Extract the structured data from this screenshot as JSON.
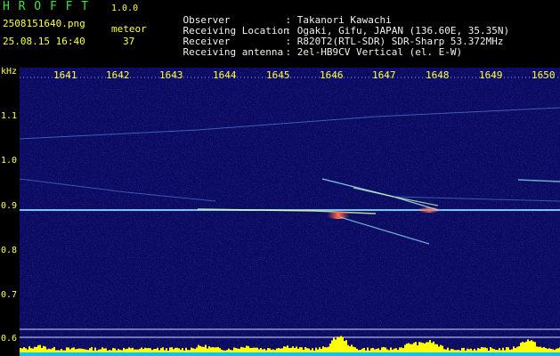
{
  "app": {
    "name": "H R O F F T",
    "version": "1.0.0"
  },
  "file": {
    "filename": "2508151640.png",
    "datetime": "25.08.15 16:40"
  },
  "counter": {
    "label": "meteor",
    "value": "37"
  },
  "station": [
    {
      "key": "Observer",
      "value": ": Takanori Kawachi"
    },
    {
      "key": "Receiving Location",
      "value": ": Ogaki, Gifu, JAPAN (136.60E, 35.35N)"
    },
    {
      "key": "Receiver",
      "value": ": R820T2(RTL-SDR) SDR-Sharp 53.372MHz"
    },
    {
      "key": "Receiving antenna",
      "value": ": 2el-HB9CV Vertical (el. E-W)"
    }
  ],
  "spectrogram": {
    "y_unit": "kHz",
    "y_ticks": [
      "1.1",
      "1.0",
      "0.9",
      "0.8",
      "0.7",
      "0.6"
    ],
    "time_ticks": [
      "1641",
      "1642",
      "1643",
      "1644",
      "1645",
      "1646",
      "1647",
      "1648",
      "1649",
      "1650"
    ],
    "colors": {
      "background": "#0a0a60",
      "carrier": "#8fd8ff",
      "hot": "#ff6040",
      "level": "#ffff00",
      "noise_floor": "#00c8ff"
    }
  }
}
